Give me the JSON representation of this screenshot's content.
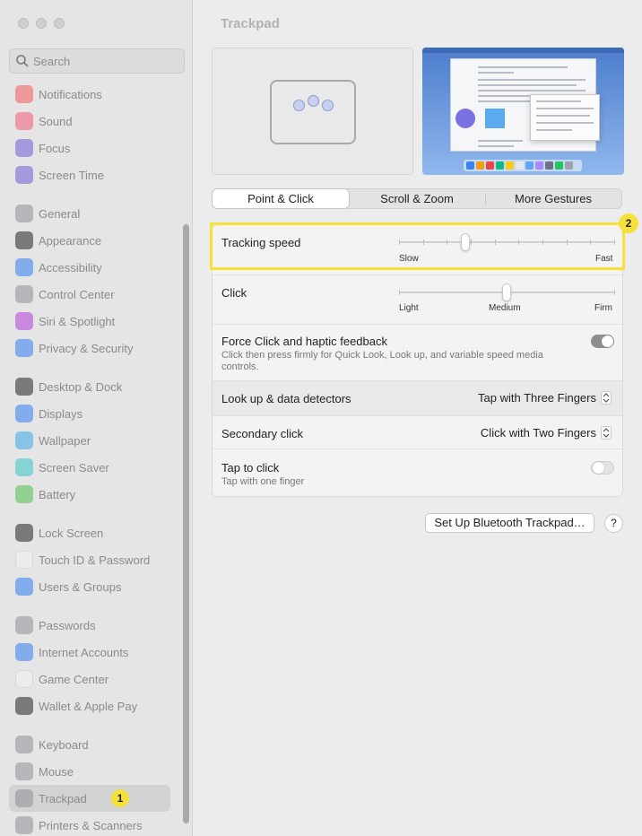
{
  "search": {
    "placeholder": "Search"
  },
  "sidebar": {
    "items": [
      {
        "label": "Notifications",
        "icon": "bell-icon",
        "color": "#f25b5b"
      },
      {
        "label": "Sound",
        "icon": "speaker-icon",
        "color": "#f25b7a"
      },
      {
        "label": "Focus",
        "icon": "moon-icon",
        "color": "#6e5bd6"
      },
      {
        "label": "Screen Time",
        "icon": "hourglass-icon",
        "color": "#6e5bd6"
      },
      {
        "label": "General",
        "icon": "gear-icon",
        "color": "#8e8e93"
      },
      {
        "label": "Appearance",
        "icon": "appearance-icon",
        "color": "#222222"
      },
      {
        "label": "Accessibility",
        "icon": "accessibility-icon",
        "color": "#2f7ef0"
      },
      {
        "label": "Control Center",
        "icon": "control-center-icon",
        "color": "#8e8e93"
      },
      {
        "label": "Siri & Spotlight",
        "icon": "siri-icon",
        "color": "#b03fd6"
      },
      {
        "label": "Privacy & Security",
        "icon": "hand-icon",
        "color": "#2f7ef0"
      },
      {
        "label": "Desktop & Dock",
        "icon": "dock-icon",
        "color": "#222222"
      },
      {
        "label": "Displays",
        "icon": "sun-icon",
        "color": "#2f7ef0"
      },
      {
        "label": "Wallpaper",
        "icon": "wallpaper-icon",
        "color": "#37a7e8"
      },
      {
        "label": "Screen Saver",
        "icon": "screen-saver-icon",
        "color": "#37c4c8"
      },
      {
        "label": "Battery",
        "icon": "battery-icon",
        "color": "#4cc04c"
      },
      {
        "label": "Lock Screen",
        "icon": "lock-icon",
        "color": "#222222"
      },
      {
        "label": "Touch ID & Password",
        "icon": "fingerprint-icon",
        "color": "#f2f2f2"
      },
      {
        "label": "Users & Groups",
        "icon": "users-icon",
        "color": "#2f7ef0"
      },
      {
        "label": "Passwords",
        "icon": "key-icon",
        "color": "#8e8e93"
      },
      {
        "label": "Internet Accounts",
        "icon": "at-icon",
        "color": "#2f7ef0"
      },
      {
        "label": "Game Center",
        "icon": "game-center-icon",
        "color": "#f2f2f2"
      },
      {
        "label": "Wallet & Apple Pay",
        "icon": "wallet-icon",
        "color": "#222222"
      },
      {
        "label": "Keyboard",
        "icon": "keyboard-icon",
        "color": "#8e8e93"
      },
      {
        "label": "Mouse",
        "icon": "mouse-icon",
        "color": "#8e8e93"
      },
      {
        "label": "Trackpad",
        "icon": "trackpad-icon",
        "color": "#8e8e93"
      },
      {
        "label": "Printers & Scanners",
        "icon": "printer-icon",
        "color": "#8e8e93"
      }
    ],
    "badge": "1"
  },
  "main": {
    "title": "Trackpad",
    "tabs": [
      {
        "label": "Point & Click",
        "active": true
      },
      {
        "label": "Scroll & Zoom",
        "active": false
      },
      {
        "label": "More Gestures",
        "active": false
      }
    ],
    "badge": "2",
    "tracking": {
      "label": "Tracking speed",
      "min_label": "Slow",
      "max_label": "Fast",
      "value": 0.31,
      "ticks": 10
    },
    "click": {
      "label": "Click",
      "labels": [
        "Light",
        "Medium",
        "Firm"
      ],
      "value": 0.5
    },
    "force_click": {
      "label": "Force Click and haptic feedback",
      "description": "Click then press firmly for Quick Look, Look up, and variable speed media controls.",
      "on": true
    },
    "lookup": {
      "label": "Look up & data detectors",
      "value": "Tap with Three Fingers"
    },
    "secondary": {
      "label": "Secondary click",
      "value": "Click with Two Fingers"
    },
    "tap": {
      "label": "Tap to click",
      "description": "Tap with one finger",
      "on": false
    },
    "bt_button": "Set Up Bluetooth Trackpad…",
    "help": "?",
    "highlight_color": "#f6e03a"
  }
}
